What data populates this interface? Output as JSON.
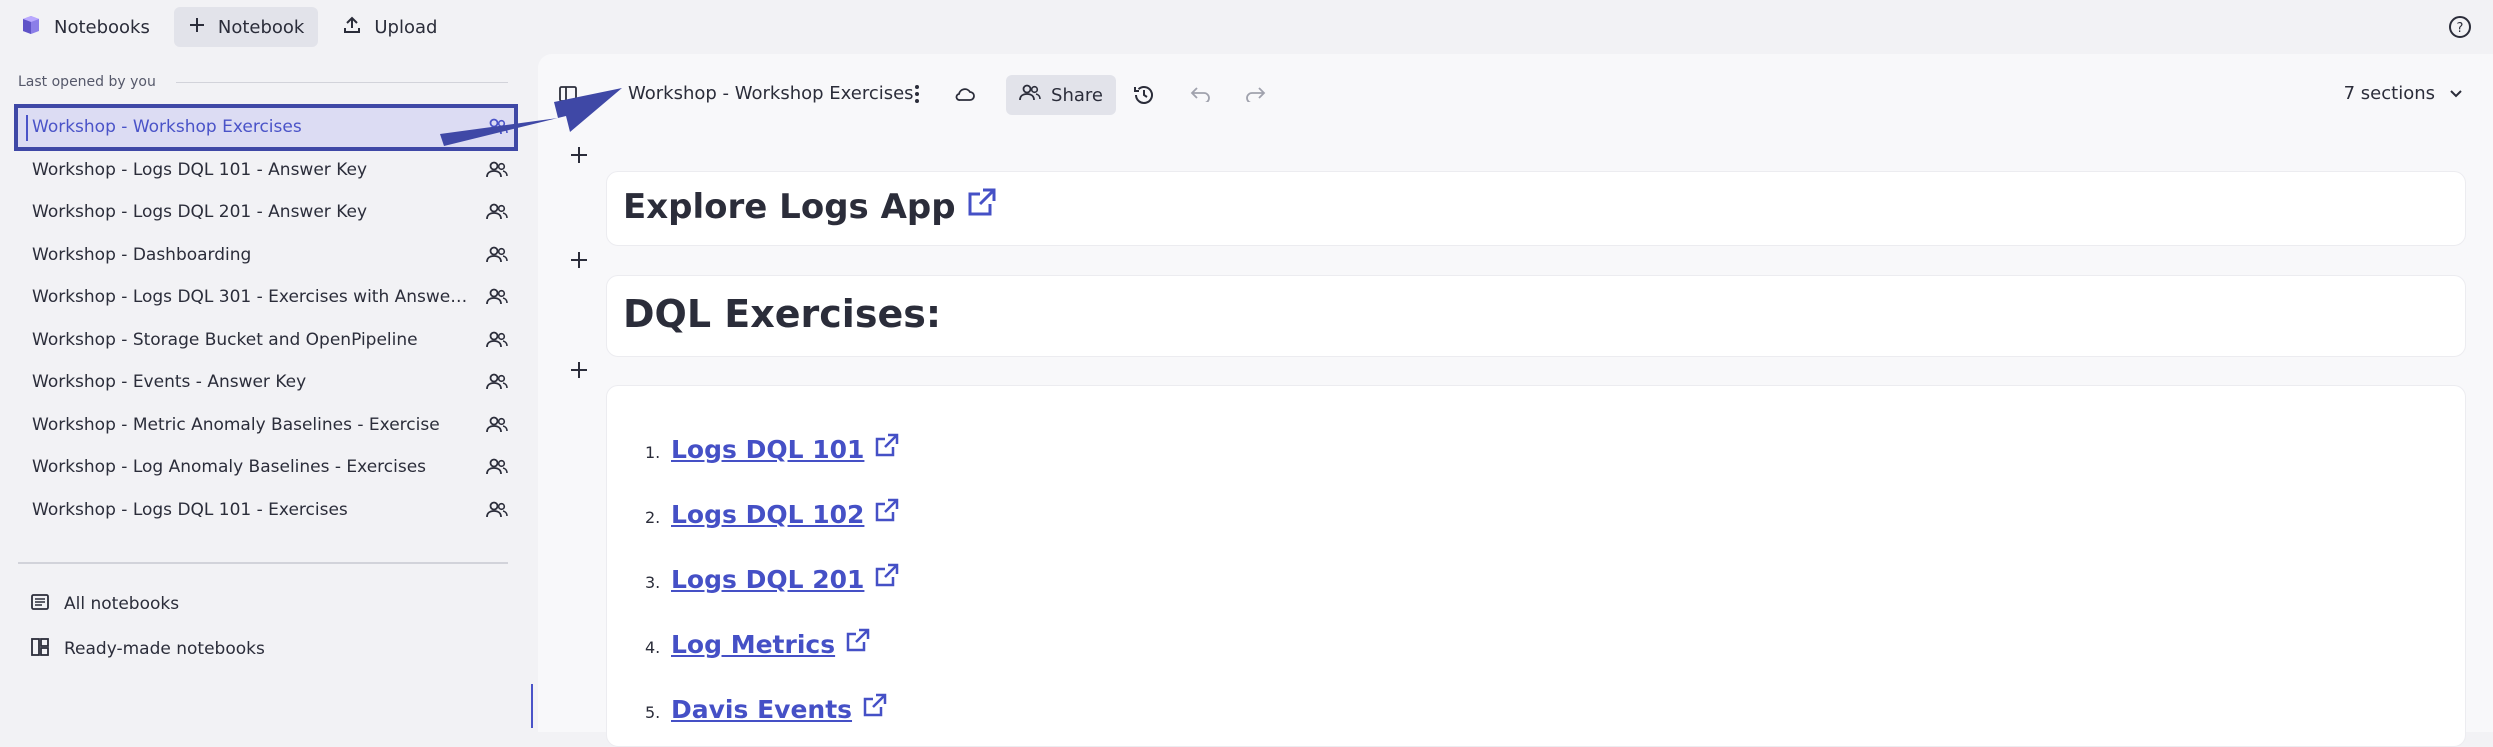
{
  "topbar": {
    "notebooks_label": "Notebooks",
    "new_notebook_label": "Notebook",
    "upload_label": "Upload"
  },
  "sidebar": {
    "section_title": "Last opened by you",
    "items": [
      "Workshop - Workshop Exercises",
      "Workshop - Logs DQL 101 - Answer Key",
      "Workshop - Logs DQL 201 - Answer Key",
      "Workshop - Dashboarding",
      "Workshop - Logs DQL 301 - Exercises with Answer Key",
      "Workshop - Storage Bucket and OpenPipeline",
      "Workshop - Events - Answer Key",
      "Workshop - Metric Anomaly Baselines - Exercise",
      "Workshop - Log Anomaly Baselines - Exercises",
      "Workshop - Logs DQL 101 - Exercises"
    ],
    "all_notebooks_label": "All notebooks",
    "ready_made_label": "Ready-made notebooks"
  },
  "notebook": {
    "title": "Workshop - Workshop Exercises",
    "share_label": "Share",
    "sections_label": "7 sections"
  },
  "content": {
    "heading1": "Explore Logs App",
    "heading2": "DQL Exercises:",
    "list": [
      {
        "num": "1.",
        "label": "Logs DQL 101"
      },
      {
        "num": "2.",
        "label": "Logs DQL 102"
      },
      {
        "num": "3.",
        "label": "Logs DQL 201"
      },
      {
        "num": "4.",
        "label": "Log Metrics"
      },
      {
        "num": "5.",
        "label": "Davis Events"
      }
    ]
  },
  "colors": {
    "accent": "#4550c6",
    "selected_bg": "#dcdcf3",
    "annotation_arrow": "#3f48a6"
  }
}
